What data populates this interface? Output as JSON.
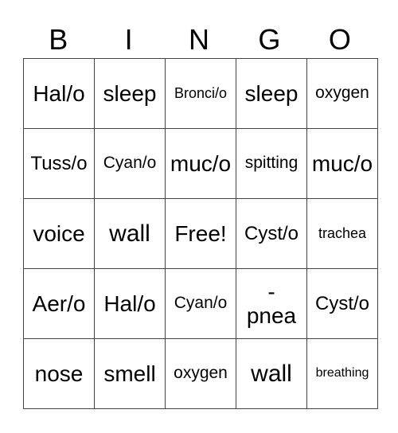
{
  "header": [
    "B",
    "I",
    "N",
    "G",
    "O"
  ],
  "rows": [
    [
      "Hal/o",
      "sleep",
      "Bronci/o",
      "sleep",
      "oxygen"
    ],
    [
      "Tuss/o",
      "Cyan/o",
      "muc/o",
      "spitting",
      "muc/o"
    ],
    [
      "voice",
      "wall",
      "Free!",
      "Cyst/o",
      "trachea"
    ],
    [
      "Aer/o",
      "Hal/o",
      "Cyan/o",
      "-\npnea",
      "Cyst/o"
    ],
    [
      "nose",
      "smell",
      "oxygen",
      "wall",
      "breathing"
    ]
  ]
}
